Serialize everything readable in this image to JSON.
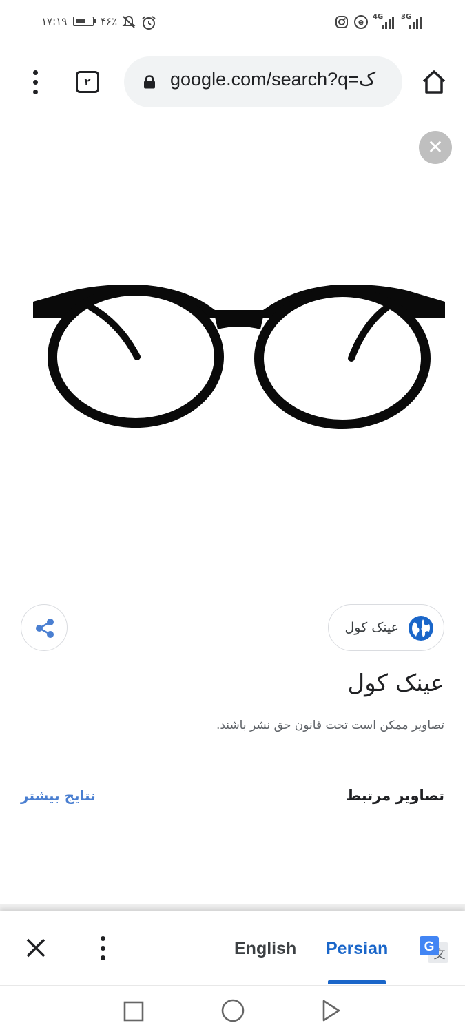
{
  "status_bar": {
    "time": "۱۷:۱۹",
    "battery_percent": "۴۶٪",
    "network_1": "4G",
    "network_2": "3G",
    "icons": [
      "battery-icon",
      "mute-icon",
      "alarm-icon",
      "instagram-icon",
      "notification-icon",
      "signal-icon"
    ]
  },
  "browser": {
    "tab_count": "۲",
    "url": "google.com/search?q=ک",
    "icons": [
      "menu-icon",
      "tabs-icon",
      "lock-icon",
      "home-icon"
    ]
  },
  "viewer": {
    "close_icon": "close-icon",
    "image_subject": "black round eyeglasses"
  },
  "info": {
    "site_name": "عینک کول",
    "title": "عینک کول",
    "copyright_note": "تصاویر ممکن است تحت قانون حق نشر باشند.",
    "related_heading": "تصاویر مرتبط",
    "more_results": "نتایج بیشتر",
    "icons": [
      "share-icon",
      "globe-icon"
    ]
  },
  "translate_bar": {
    "lang_source": "English",
    "lang_target": "Persian",
    "selected": "Persian",
    "icons": [
      "close-icon",
      "menu-icon",
      "google-translate-icon"
    ]
  },
  "nav_bar": {
    "icons": [
      "back-square-icon",
      "home-circle-icon",
      "recent-triangle-icon"
    ]
  },
  "colors": {
    "accent": "#1a66c9",
    "link": "#4a7fd1",
    "omnibox_bg": "#f1f3f4"
  }
}
